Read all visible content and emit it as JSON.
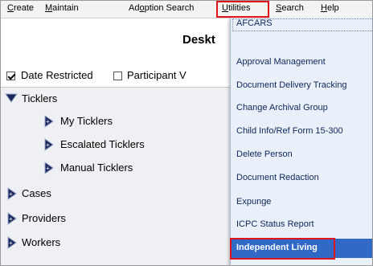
{
  "menubar": {
    "items": [
      {
        "label": "Create",
        "ul": "C",
        "rest": "reate"
      },
      {
        "label": "Maintain",
        "ul": "M",
        "rest": "aintain"
      },
      {
        "label": "Adoption Search",
        "pre": "Ad",
        "ul": "o",
        "rest": "ption Search"
      },
      {
        "label": "Utilities",
        "ul": "U",
        "rest": "tilities"
      },
      {
        "label": "Search",
        "ul": "S",
        "rest": "earch"
      },
      {
        "label": "Help",
        "ul": "H",
        "rest": "elp"
      }
    ]
  },
  "desktop_title": "Deskt",
  "filters": {
    "date_restricted": {
      "label": "Date Restricted",
      "checked": true
    },
    "participant": {
      "label": "Participant V",
      "checked": false
    }
  },
  "tree": {
    "tickler": "Ticklers",
    "my_ticklers": "My Ticklers",
    "escalated": "Escalated Ticklers",
    "manual": "Manual Ticklers",
    "cases": "Cases",
    "providers": "Providers",
    "workers": "Workers"
  },
  "utilities_menu": {
    "items": [
      "AFCARS",
      "Approval Management",
      "Document Delivery Tracking",
      "Change Archival Group",
      "Child Info/Ref Form 15-300",
      "Delete Person",
      "Document Redaction",
      "Expunge",
      "ICPC Status Report",
      "Independent Living"
    ],
    "active_item": "Independent Living"
  },
  "colors": {
    "highlight_box": "#e0141b",
    "menu_selected": "#3169c6",
    "menu_bg": "#eaf0fa",
    "tree_bg": "#eef0f3"
  },
  "icons": {
    "expanded": "triangle-down-icon",
    "collapsed": "triangle-right-icon"
  }
}
